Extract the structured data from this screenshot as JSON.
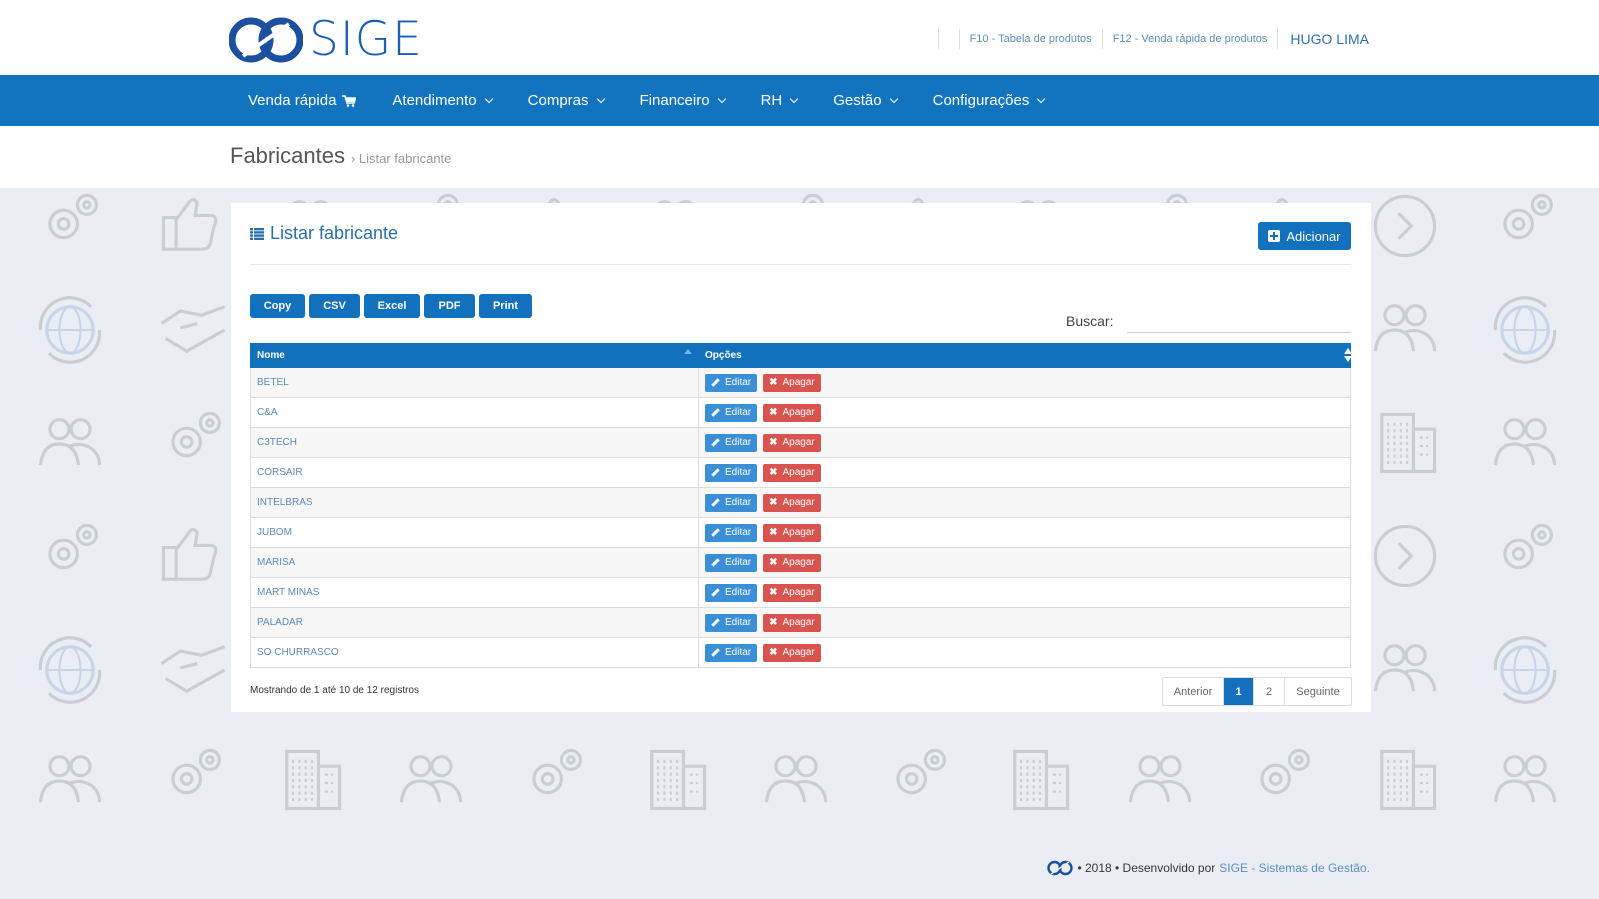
{
  "header": {
    "logo_text": "SIGE",
    "links": [
      "F10 - Tabela de produtos",
      "F12 - Venda rápida de produtos"
    ],
    "user": "HUGO LIMA"
  },
  "nav": {
    "items": [
      {
        "label": "Venda rápida",
        "icon": "cart-icon"
      },
      {
        "label": "Atendimento"
      },
      {
        "label": "Compras"
      },
      {
        "label": "Financeiro"
      },
      {
        "label": "RH"
      },
      {
        "label": "Gestão"
      },
      {
        "label": "Configurações"
      }
    ]
  },
  "breadcrumb": {
    "title": "Fabricantes",
    "current": "Listar fabricante"
  },
  "panel": {
    "title": "Listar fabricante",
    "add_label": "Adicionar",
    "export_buttons": [
      "Copy",
      "CSV",
      "Excel",
      "PDF",
      "Print"
    ],
    "search_label": "Buscar:",
    "search_value": ""
  },
  "table": {
    "columns": [
      "Nome",
      "Opções"
    ],
    "edit_label": "Editar",
    "delete_label": "Apagar",
    "rows": [
      "BETEL",
      "C&A",
      "C3TECH",
      "CORSAIR",
      "INTELBRAS",
      "JUBOM",
      "MARISA",
      "MART MINAS",
      "PALADAR",
      "SO CHURRASCO"
    ]
  },
  "pagination": {
    "info": "Mostrando de 1 até 10 de 12 registros",
    "prev": "Anterior",
    "pages": [
      "1",
      "2"
    ],
    "active_page": "1",
    "next": "Seguinte"
  },
  "footer": {
    "text": "• 2018 • Desenvolvido por",
    "brand": "SIGE - Sistemas de Gestão."
  },
  "colors": {
    "primary": "#1370bd",
    "danger": "#d9534f",
    "background": "#eaeef4"
  }
}
